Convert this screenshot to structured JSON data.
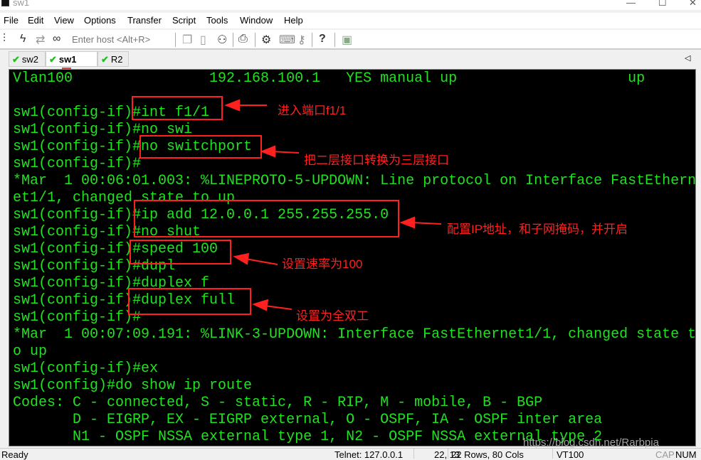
{
  "window": {
    "title": "sw1",
    "minimize": "—",
    "maximize": "☐",
    "close": "✕"
  },
  "menu": [
    "File",
    "Edit",
    "View",
    "Options",
    "Transfer",
    "Script",
    "Tools",
    "Window",
    "Help"
  ],
  "toolbar": {
    "host_placeholder": "Enter host <Alt+R>",
    "icons": [
      "connect-icon",
      "lightning-icon",
      "reconnect-icon",
      "disconnect-icon",
      "copy-icon",
      "paste-icon",
      "find-icon",
      "print-icon",
      "settings-icon",
      "keymap-icon",
      "key-icon",
      "help-icon",
      "sftp-icon"
    ]
  },
  "tabs": [
    {
      "label": "sw2",
      "status": "connected"
    },
    {
      "label": "sw1",
      "status": "connected",
      "active": true,
      "close": "x"
    },
    {
      "label": "R2",
      "status": "connected"
    }
  ],
  "tab_scroll": "◁",
  "terminal": {
    "lines": [
      "Vlan100                192.168.100.1   YES manual up                    up",
      "",
      "sw1(config-if)#int f1/1",
      "sw1(config-if)#no swi",
      "sw1(config-if)#no switchport",
      "sw1(config-if)#",
      "*Mar  1 00:06:01.003: %LINEPROTO-5-UPDOWN: Line protocol on Interface FastEthern",
      "et1/1, changed state to up",
      "sw1(config-if)#ip add 12.0.0.1 255.255.255.0",
      "sw1(config-if)#no shut",
      "sw1(config-if)#speed 100",
      "sw1(config-if)#dupl",
      "sw1(config-if)#duplex f",
      "sw1(config-if)#duplex full",
      "sw1(config-if)#",
      "*Mar  1 00:07:09.191: %LINK-3-UPDOWN: Interface FastEthernet1/1, changed state t",
      "o up",
      "sw1(config-if)#ex",
      "sw1(config)#do show ip route",
      "Codes: C - connected, S - static, R - RIP, M - mobile, B - BGP",
      "       D - EIGRP, EX - EIGRP external, O - OSPF, IA - OSPF inter area",
      "       N1 - OSPF NSSA external type 1, N2 - OSPF NSSA external type 2"
    ]
  },
  "annotations": [
    "进入端口f1/1",
    "把二层接口转换为三层接口",
    "配置IP地址，和子网掩码，并开启",
    "设置速率为100",
    "设置为全双工"
  ],
  "annotation_color": "#ff2020",
  "watermark": "https://blog.csdn.net/Rarbpia",
  "status": {
    "ready": "Ready",
    "connection": "Telnet: 127.0.0.1",
    "cursor": "22, 13",
    "size": "22 Rows, 80 Cols",
    "emulation": "VT100",
    "cap": "CAP",
    "num": "NUM"
  }
}
